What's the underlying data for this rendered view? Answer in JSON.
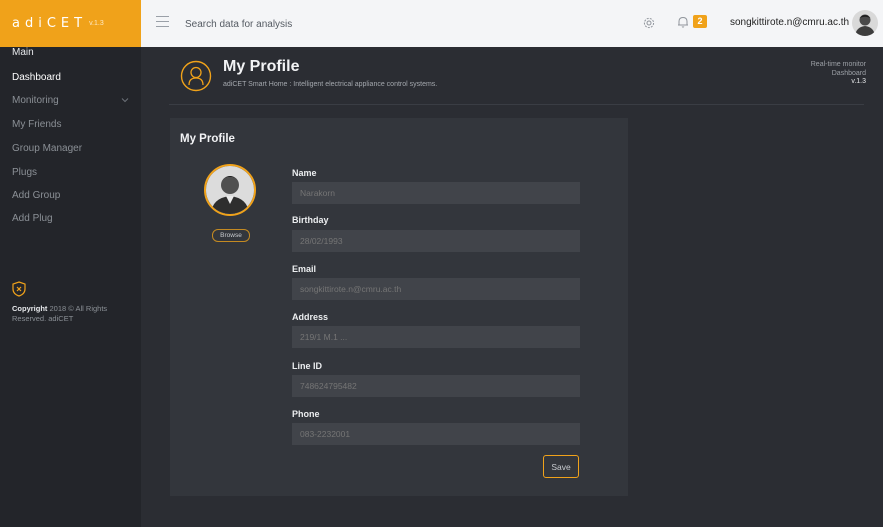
{
  "app": {
    "name": "adiCET",
    "version": "v.1.3"
  },
  "topbar": {
    "search_placeholder": "Search data for analysis",
    "notification_count": "2",
    "user_email": "songkittirote.n@cmru.ac.th"
  },
  "sidebar": {
    "items": [
      {
        "label": "Main"
      },
      {
        "label": "Dashboard"
      },
      {
        "label": "Monitoring"
      },
      {
        "label": "My Friends"
      },
      {
        "label": "Group Manager"
      },
      {
        "label": "Plugs"
      },
      {
        "label": "Add Group"
      },
      {
        "label": "Add Plug"
      }
    ],
    "copyright_bold": "Copyright",
    "copyright_rest": "2018 © All Rights Reserved. adiCET"
  },
  "header": {
    "title": "My Profile",
    "subtitle": "adiCET Smart Home : Intelligent electrical appliance control systems.",
    "realtime_line1": "Real-time monitor",
    "realtime_line2": "Dashboard",
    "realtime_version": "v.1.3"
  },
  "profile": {
    "card_title": "My Profile",
    "browse_label": "Browse",
    "fields": [
      {
        "label": "Name",
        "value": "Narakorn"
      },
      {
        "label": "Birthday",
        "value": "28/02/1993"
      },
      {
        "label": "Email",
        "value": "songkittirote.n@cmru.ac.th"
      },
      {
        "label": "Address",
        "value": "219/1 M.1 ..."
      },
      {
        "label": "Line ID",
        "value": "748624795482"
      },
      {
        "label": "Phone",
        "value": "083-2232001"
      }
    ],
    "save_label": "Save"
  },
  "colors": {
    "accent": "#f0a21a",
    "sidebar_bg": "#23252a",
    "content_bg": "#2b2d33",
    "card_bg": "#33363c"
  },
  "icons": {
    "menu": "hamburger-menu-icon",
    "settings": "gear-icon",
    "notifications": "bell-icon",
    "collapse": "chevron-down-icon",
    "footer": "shield-x-icon",
    "header": "user-circle-icon"
  }
}
